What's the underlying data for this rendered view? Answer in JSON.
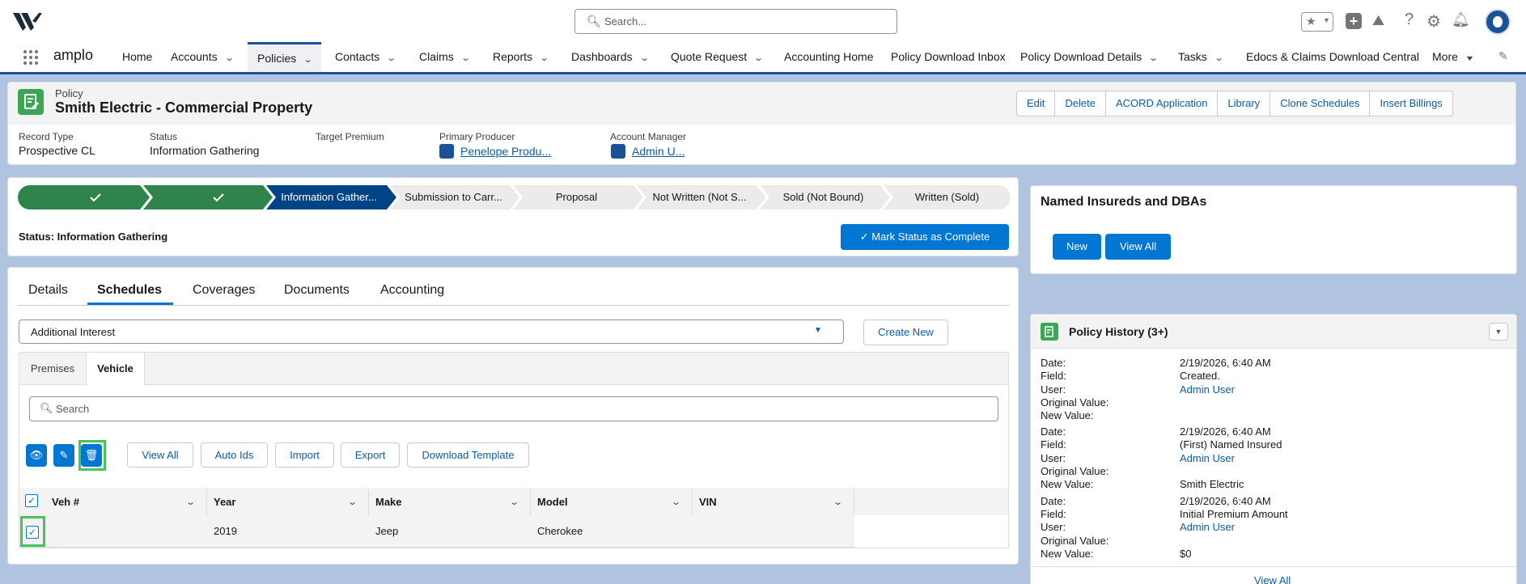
{
  "header": {
    "search_placeholder": "Search...",
    "app_name": "amplo"
  },
  "nav": [
    {
      "label": "Home",
      "chevron": false
    },
    {
      "label": "Accounts",
      "chevron": true
    },
    {
      "label": "Policies",
      "chevron": true,
      "active": true
    },
    {
      "label": "Contacts",
      "chevron": true
    },
    {
      "label": "Claims",
      "chevron": true
    },
    {
      "label": "Reports",
      "chevron": true
    },
    {
      "label": "Dashboards",
      "chevron": true
    },
    {
      "label": "Quote Request",
      "chevron": true
    },
    {
      "label": "Accounting Home",
      "chevron": false
    },
    {
      "label": "Policy Download Inbox",
      "chevron": false
    },
    {
      "label": "Policy Download Details",
      "chevron": true
    },
    {
      "label": "Tasks",
      "chevron": true
    },
    {
      "label": "Edocs & Claims Download Central",
      "chevron": false
    },
    {
      "label": "More",
      "chevron": true
    }
  ],
  "record": {
    "object_label": "Policy",
    "title": "Smith Electric - Commercial Property",
    "actions": [
      "Edit",
      "Delete",
      "ACORD Application",
      "Library",
      "Clone Schedules",
      "Insert Billings"
    ],
    "fields": [
      {
        "label": "Record Type",
        "value": "Prospective CL"
      },
      {
        "label": "Status",
        "value": "Information Gathering"
      },
      {
        "label": "Target Premium",
        "value": ""
      },
      {
        "label": "Primary Producer",
        "value": "Penelope Produ..."
      },
      {
        "label": "Account Manager",
        "value": "Admin U..."
      }
    ]
  },
  "path": {
    "steps": [
      "",
      "",
      "Information Gather...",
      "Submission to Carr...",
      "Proposal",
      "Not Written (Not S...",
      "Sold (Not Bound)",
      "Written (Sold)"
    ],
    "status_text": "Status: Information Gathering",
    "mark_complete": "Mark Status as Complete"
  },
  "tabs": [
    "Details",
    "Schedules",
    "Coverages",
    "Documents",
    "Accounting"
  ],
  "schedules": {
    "select_value": "Additional Interest",
    "create_new": "Create New",
    "subtabs": [
      "Premises",
      "Vehicle"
    ],
    "search_placeholder": "Search",
    "buttons": [
      "View All",
      "Auto Ids",
      "Import",
      "Export",
      "Download Template"
    ],
    "columns": [
      "Veh #",
      "Year",
      "Make",
      "Model",
      "VIN"
    ],
    "rows": [
      {
        "veh": "",
        "year": "2019",
        "make": "Jeep",
        "model": "Cherokee",
        "vin": ""
      }
    ]
  },
  "named_insureds": {
    "title": "Named Insureds and DBAs",
    "new": "New",
    "view_all": "View All"
  },
  "history": {
    "title": "Policy History (3+)",
    "labels": [
      "Date:",
      "Field:",
      "User:",
      "Original Value:",
      "New Value:"
    ],
    "entries": [
      {
        "date": "2/19/2026, 6:40 AM",
        "field": "Created.",
        "user": "Admin User",
        "original": "",
        "new": ""
      },
      {
        "date": "2/19/2026, 6:40 AM",
        "field": "(First) Named Insured",
        "user": "Admin User",
        "original": "",
        "new": "Smith Electric"
      },
      {
        "date": "2/19/2026, 6:40 AM",
        "field": "Initial Premium Amount",
        "user": "Admin User",
        "original": "",
        "new": "$0"
      }
    ],
    "view_all": "View All"
  },
  "colors": {
    "brand": "#0176d3",
    "path_complete": "#2e844a",
    "path_current": "#014486",
    "highlight": "#45c65a"
  }
}
